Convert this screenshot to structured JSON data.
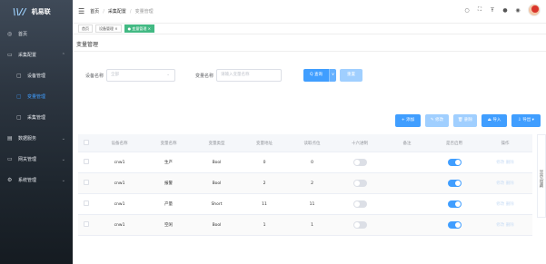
{
  "app": {
    "name": "机易联"
  },
  "sidebar": {
    "items": [
      {
        "label": "首页",
        "icon": "home-icon"
      },
      {
        "label": "采集配置",
        "icon": "folder-icon",
        "expanded": true
      },
      {
        "label": "设备管理",
        "icon": "device-icon",
        "sub": true
      },
      {
        "label": "变量管理",
        "icon": "variable-icon",
        "sub": true,
        "active": true
      },
      {
        "label": "采集管理",
        "icon": "collect-icon",
        "sub": true
      },
      {
        "label": "数据服务",
        "icon": "data-icon"
      },
      {
        "label": "网关管理",
        "icon": "gateway-icon"
      },
      {
        "label": "系统管理",
        "icon": "settings-icon"
      }
    ]
  },
  "header": {
    "breadcrumb": [
      "首页",
      "采集配置",
      "变量管理"
    ]
  },
  "tags": [
    {
      "label": "首页",
      "active": false
    },
    {
      "label": "设备管理 ×",
      "active": false
    },
    {
      "label": "● 变量管理 ×",
      "active": true
    }
  ],
  "page": {
    "title": "变量管理"
  },
  "filters": {
    "device_label": "设备名称",
    "device_placeholder": "全部",
    "variable_label": "变量名称",
    "variable_placeholder": "请输入变量名称",
    "query_label": "Q 查询",
    "reset_label": "重置"
  },
  "toolbar": {
    "add": "+ 添加",
    "edit": "✎ 修改",
    "delete": "🗑 删除",
    "import": "⏏ 导入",
    "export": "⇩ 导出 ▾"
  },
  "table": {
    "columns": [
      "设备名称",
      "变量名称",
      "变量类型",
      "变量地址",
      "读取点位",
      "十六进制",
      "备注",
      "是否启用",
      "操作"
    ],
    "rows": [
      {
        "device": "cnw1",
        "name": "生产",
        "type": "Bool",
        "addr": "0",
        "point": "0",
        "hex": false,
        "note": "",
        "enabled": true,
        "ops": "修改 删除"
      },
      {
        "device": "cnw1",
        "name": "报警",
        "type": "Bool",
        "addr": "2",
        "point": "2",
        "hex": false,
        "note": "",
        "enabled": true,
        "ops": "修改 删除"
      },
      {
        "device": "cnw1",
        "name": "产量",
        "type": "Short",
        "addr": "11",
        "point": "11",
        "hex": false,
        "note": "",
        "enabled": true,
        "ops": "修改 删除"
      },
      {
        "device": "cnw1",
        "name": "空闲",
        "type": "Bool",
        "addr": "1",
        "point": "1",
        "hex": false,
        "note": "",
        "enabled": true,
        "ops": "修改 删除"
      }
    ]
  },
  "side_tab": {
    "label": "显示/隐藏"
  },
  "colors": {
    "primary": "#409eff",
    "tag_active": "#42b983",
    "sidebar_bg": "#2c3540"
  }
}
